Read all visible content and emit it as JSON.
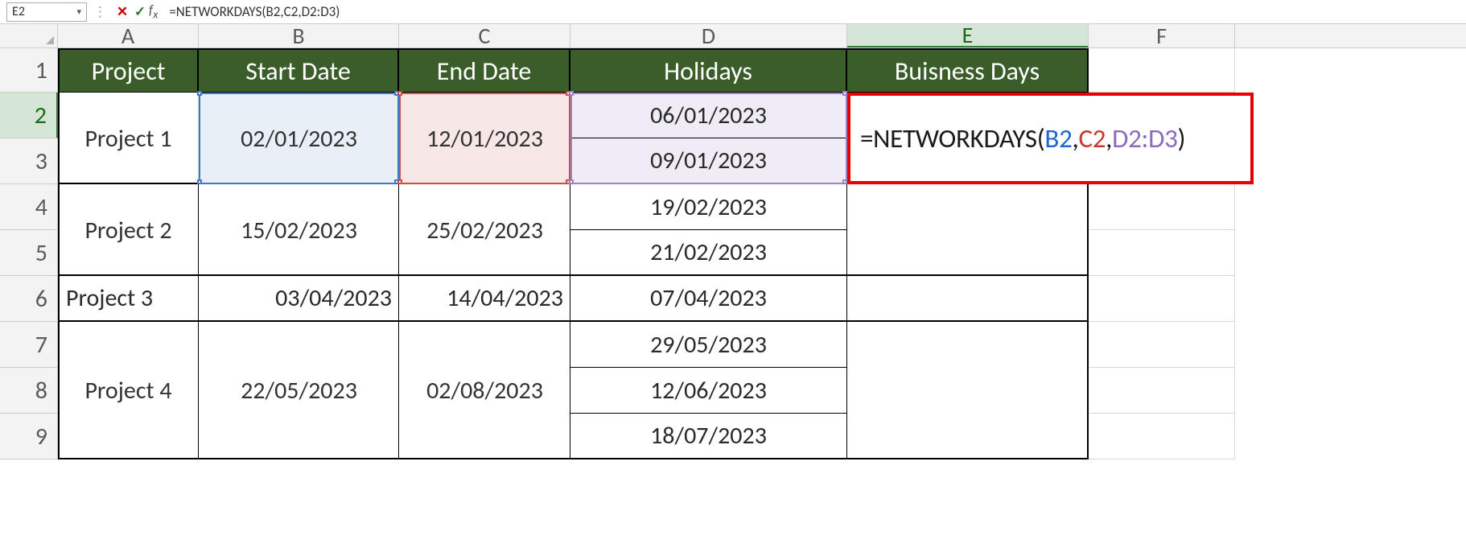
{
  "formula_bar": {
    "name_box": "E2",
    "formula": "=NETWORKDAYS(B2,C2,D2:D3)"
  },
  "columns": {
    "A": "A",
    "B": "B",
    "C": "C",
    "D": "D",
    "E": "E",
    "F": "F"
  },
  "rows": [
    "1",
    "2",
    "3",
    "4",
    "5",
    "6",
    "7",
    "8",
    "9"
  ],
  "headers": {
    "project": "Project",
    "start": "Start Date",
    "end": "End Date",
    "holidays": "Holidays",
    "business": "Buisness Days"
  },
  "data": {
    "p1": {
      "name": "Project 1",
      "start": "02/01/2023",
      "end": "12/01/2023",
      "holidays": [
        "06/01/2023",
        "09/01/2023"
      ]
    },
    "p2": {
      "name": "Project 2",
      "start": "15/02/2023",
      "end": "25/02/2023",
      "holidays": [
        "19/02/2023",
        "21/02/2023"
      ]
    },
    "p3": {
      "name": "Project 3",
      "start": "03/04/2023",
      "end": "14/04/2023",
      "holidays": [
        "07/04/2023"
      ]
    },
    "p4": {
      "name": "Project 4",
      "start": "22/05/2023",
      "end": "02/08/2023",
      "holidays": [
        "29/05/2023",
        "12/06/2023",
        "18/07/2023"
      ]
    }
  },
  "formula_tokens": {
    "prefix": "=NETWORKDAYS(",
    "ref1": "B2",
    "sep": ",",
    "ref2": "C2",
    "ref3": "D2:D3",
    "suffix": ")"
  }
}
